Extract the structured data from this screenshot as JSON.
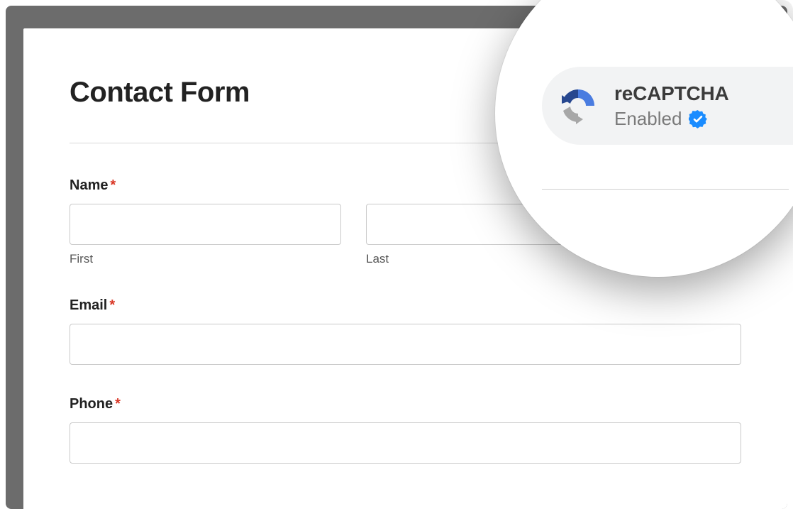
{
  "form": {
    "title": "Contact Form",
    "fields": {
      "name": {
        "label": "Name",
        "required_mark": "*",
        "first_sublabel": "First",
        "last_sublabel": "Last",
        "first_value": "",
        "last_value": ""
      },
      "email": {
        "label": "Email",
        "required_mark": "*",
        "value": ""
      },
      "phone": {
        "label": "Phone",
        "required_mark": "*",
        "value": ""
      }
    }
  },
  "recaptcha_callout": {
    "title": "reCAPTCHA",
    "status": "Enabled",
    "icon": "recaptcha-icon",
    "verified_icon": "verified-badge-icon"
  },
  "colors": {
    "recaptcha_blue_dark": "#27478f",
    "recaptcha_blue": "#4a7ce0",
    "recaptcha_gray": "#a7a7a7",
    "verified_blue": "#1a8cff"
  }
}
